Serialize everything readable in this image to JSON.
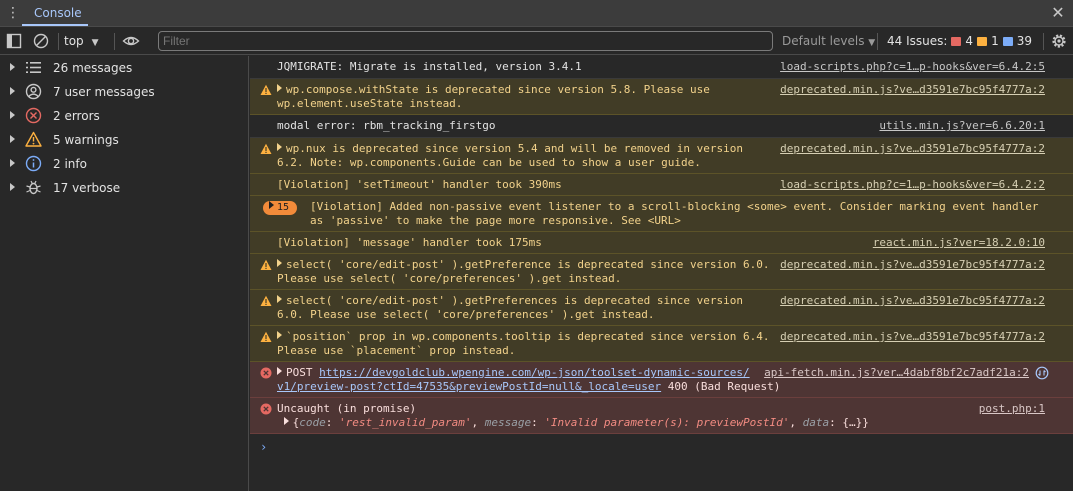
{
  "tabbar": {
    "tab_label": "Console",
    "close_glyph": "✕",
    "menu_glyph": "⋮"
  },
  "toolbar": {
    "context": "top",
    "filter_placeholder": "Filter",
    "levels_label": "Default levels",
    "issues_label": "44 Issues:",
    "issues_errors": "4",
    "issues_warnings": "1",
    "issues_info": "39"
  },
  "sidebar": {
    "items": [
      {
        "label": "26 messages",
        "icon": "list-icon"
      },
      {
        "label": "7 user messages",
        "icon": "user-icon"
      },
      {
        "label": "2 errors",
        "icon": "error-icon"
      },
      {
        "label": "5 warnings",
        "icon": "warning-icon"
      },
      {
        "label": "2 info",
        "icon": "info-icon"
      },
      {
        "label": "17 verbose",
        "icon": "bug-icon"
      }
    ]
  },
  "messages": [
    {
      "level": "log",
      "text": "JQMIGRATE: Migrate is installed, version 3.4.1",
      "source": "load-scripts.php?c=1…p-hooks&ver=6.4.2:5"
    },
    {
      "level": "warn",
      "text1": "wp.compose.withState is deprecated since version 5.8. Please use",
      "text2": "wp.element.useState instead.",
      "source": "deprecated.min.js?ve…d3591e7bc95f4777a:2"
    },
    {
      "level": "log",
      "text": "modal error: rbm_tracking_firstgo",
      "source": "utils.min.js?ver=6.6.20:1"
    },
    {
      "level": "warn",
      "text1": "wp.nux is deprecated since version 5.4 and will be removed in version",
      "text2": "6.2. Note: wp.components.Guide can be used to show a user guide.",
      "source": "deprecated.min.js?ve…d3591e7bc95f4777a:2"
    },
    {
      "level": "viol",
      "text": "[Violation] 'setTimeout' handler took 390ms",
      "source": "load-scripts.php?c=1…p-hooks&ver=6.4.2:2"
    },
    {
      "level": "viol",
      "count": "15",
      "text1": "[Violation] Added non-passive event listener to a scroll-blocking <some> event. Consider marking event handler",
      "text2": "as 'passive' to make the page more responsive. See <URL>"
    },
    {
      "level": "viol",
      "text": "[Violation] 'message' handler took 175ms",
      "source": "react.min.js?ver=18.2.0:10"
    },
    {
      "level": "warn",
      "text1": "select( 'core/edit-post' ).getPreference is deprecated since version 6.0.",
      "text2": "Please use select( 'core/preferences' ).get instead.",
      "source": "deprecated.min.js?ve…d3591e7bc95f4777a:2"
    },
    {
      "level": "warn",
      "text1": "select( 'core/edit-post' ).getPreferences is deprecated since version",
      "text2": "6.0. Please use select( 'core/preferences' ).get instead.",
      "source": "deprecated.min.js?ve…d3591e7bc95f4777a:2"
    },
    {
      "level": "warn",
      "text1": "`position` prop in wp.components.tooltip is deprecated since version 6.4.",
      "text2": "Please use `placement` prop instead.",
      "source": "deprecated.min.js?ve…d3591e7bc95f4777a:2"
    },
    {
      "level": "err",
      "method": "POST",
      "url1": "https://devgoldclub.wpengine.com/wp-json/toolset-dynamic-sources/",
      "url2": "v1/preview-post?ctId=47535&previewPostId=null&_locale=user",
      "status": "400 (Bad Request)",
      "source": "api-fetch.min.js?ver…4dabf8bf2c7adf21a:2"
    },
    {
      "level": "err",
      "text1": "Uncaught (in promise)",
      "obj_open": "{",
      "k1": "code",
      "v1": "'rest_invalid_param'",
      "k2": "message",
      "v2": "'Invalid parameter(s): previewPostId'",
      "k3": "data",
      "v3": "{…}",
      "obj_close": "}",
      "source": "post.php:1"
    }
  ],
  "prompt": "›"
}
